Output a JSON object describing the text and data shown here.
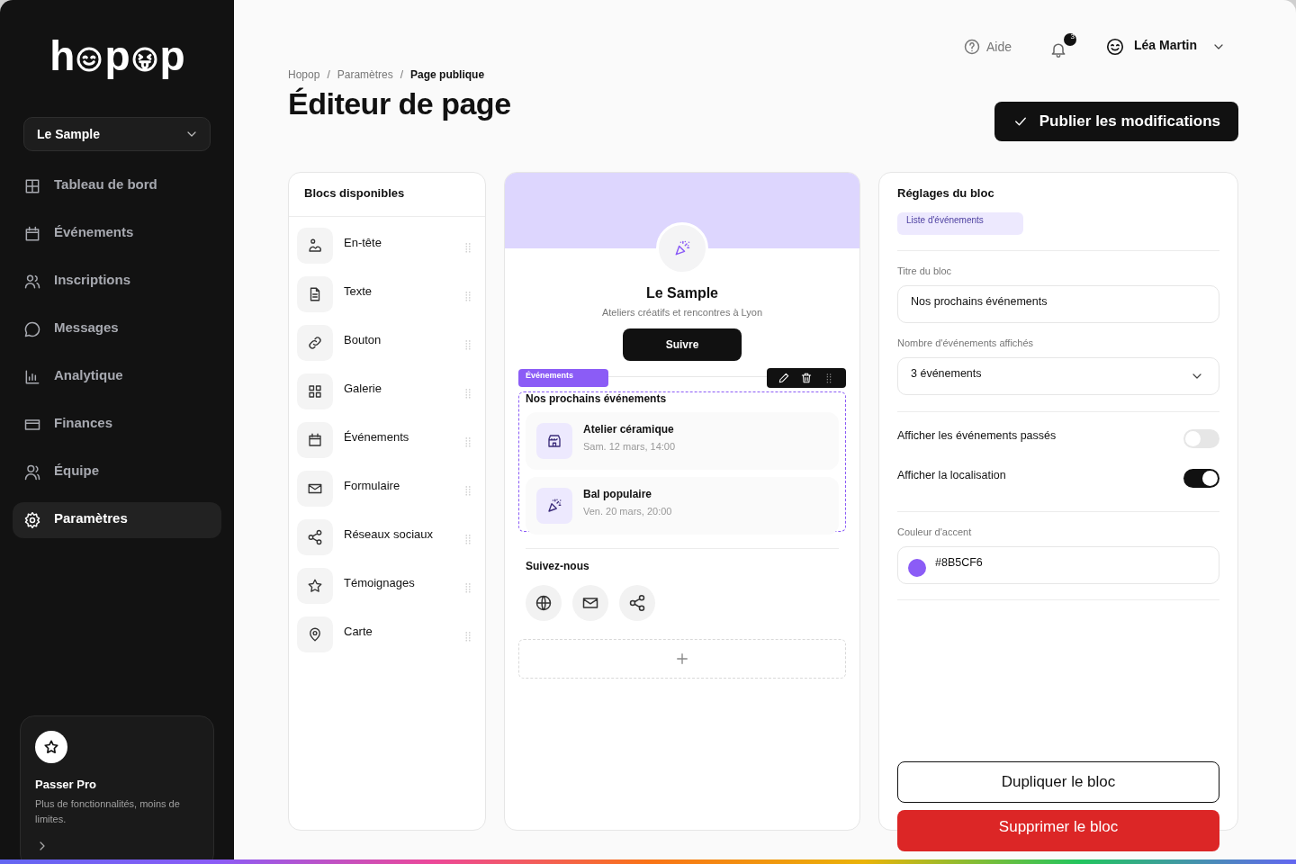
{
  "logo": {
    "letters": [
      "h",
      "p",
      "p"
    ]
  },
  "workspace_select": {
    "value": "Le Sample"
  },
  "nav": [
    {
      "label": "Tableau de bord",
      "selected": false
    },
    {
      "label": "Événements",
      "selected": false
    },
    {
      "label": "Inscriptions",
      "selected": false
    },
    {
      "label": "Messages",
      "selected": false
    },
    {
      "label": "Analytique",
      "selected": false
    },
    {
      "label": "Finances",
      "selected": false
    },
    {
      "label": "Équipe",
      "selected": false
    },
    {
      "label": "Paramètres",
      "selected": true
    }
  ],
  "upgrade": {
    "title": "Passer Pro",
    "text": "Plus de fonctionnalités, moins de limites."
  },
  "topbar": {
    "help": "Aide",
    "notifications": "3",
    "user": "Léa Martin"
  },
  "breadcrumb": [
    {
      "label": "Hopop",
      "current": false
    },
    {
      "separator": "/",
      "label": "Paramètres",
      "current": false
    },
    {
      "separator": "/",
      "label": "Page publique",
      "current": true
    }
  ],
  "title": "Éditeur de page",
  "publish_button": "Publier les modifications",
  "blocks_panel": {
    "title": "Blocs disponibles",
    "items": [
      {
        "label": "En-tête"
      },
      {
        "label": "Texte"
      },
      {
        "label": "Bouton"
      },
      {
        "label": "Galerie"
      },
      {
        "label": "Événements"
      },
      {
        "label": "Formulaire"
      },
      {
        "label": "Réseaux sociaux"
      },
      {
        "label": "Témoignages"
      },
      {
        "label": "Carte"
      }
    ]
  },
  "preview": {
    "name": "Le Sample",
    "tagline": "Ateliers créatifs et rencontres à Lyon",
    "follow_button": "Suivre",
    "selected_block": {
      "tag": "Événements",
      "title": "Nos prochains événements",
      "events": [
        {
          "title": "Atelier céramique",
          "date": "Sam. 12 mars, 14:00"
        },
        {
          "title": "Bal populaire",
          "date": "Ven. 20 mars, 20:00"
        }
      ]
    },
    "social_title": "Suivez-nous"
  },
  "settings": {
    "title": "Réglages du bloc",
    "block_type": "Liste d'événements",
    "fields": [
      {
        "kind": "text",
        "label": "Titre du bloc",
        "value": "Nos prochains événements"
      },
      {
        "kind": "select",
        "label": "Nombre d'événements affichés",
        "value": "3 événements"
      }
    ],
    "toggles": [
      {
        "label": "Afficher les événements passés",
        "on": false
      },
      {
        "label": "Afficher la localisation",
        "on": true
      }
    ],
    "accent": {
      "label": "Couleur d'accent",
      "value": "#8B5CF6",
      "color": "#8b5cf6"
    },
    "duplicate_button": "Dupliquer le bloc",
    "delete_button": "Supprimer le bloc"
  }
}
